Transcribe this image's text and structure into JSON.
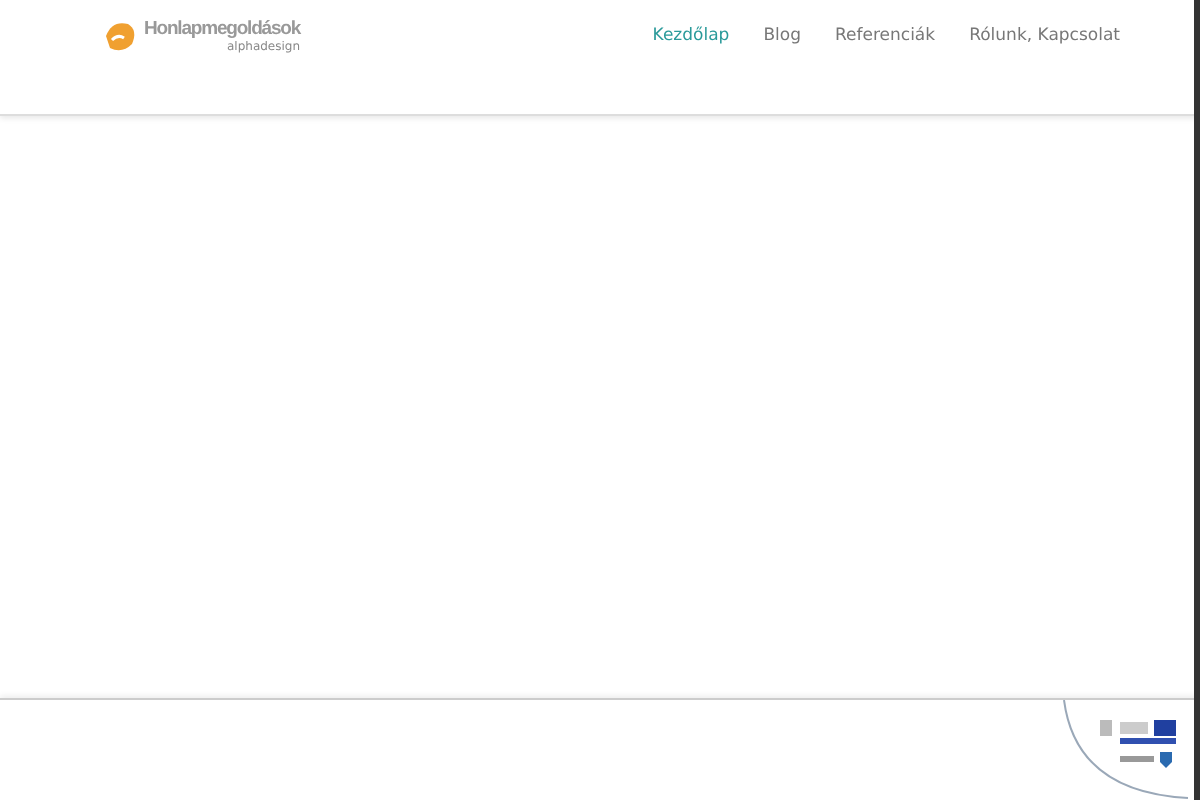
{
  "logo": {
    "name": "Honlapmegoldások",
    "tagline": "alphadesign"
  },
  "nav": [
    {
      "label": "Kezdőlap",
      "selected": true
    },
    {
      "label": "Blog",
      "selected": false
    },
    {
      "label": "Referenciák",
      "selected": false
    },
    {
      "label": "Rólunk, Kapcsolat",
      "selected": false
    }
  ]
}
